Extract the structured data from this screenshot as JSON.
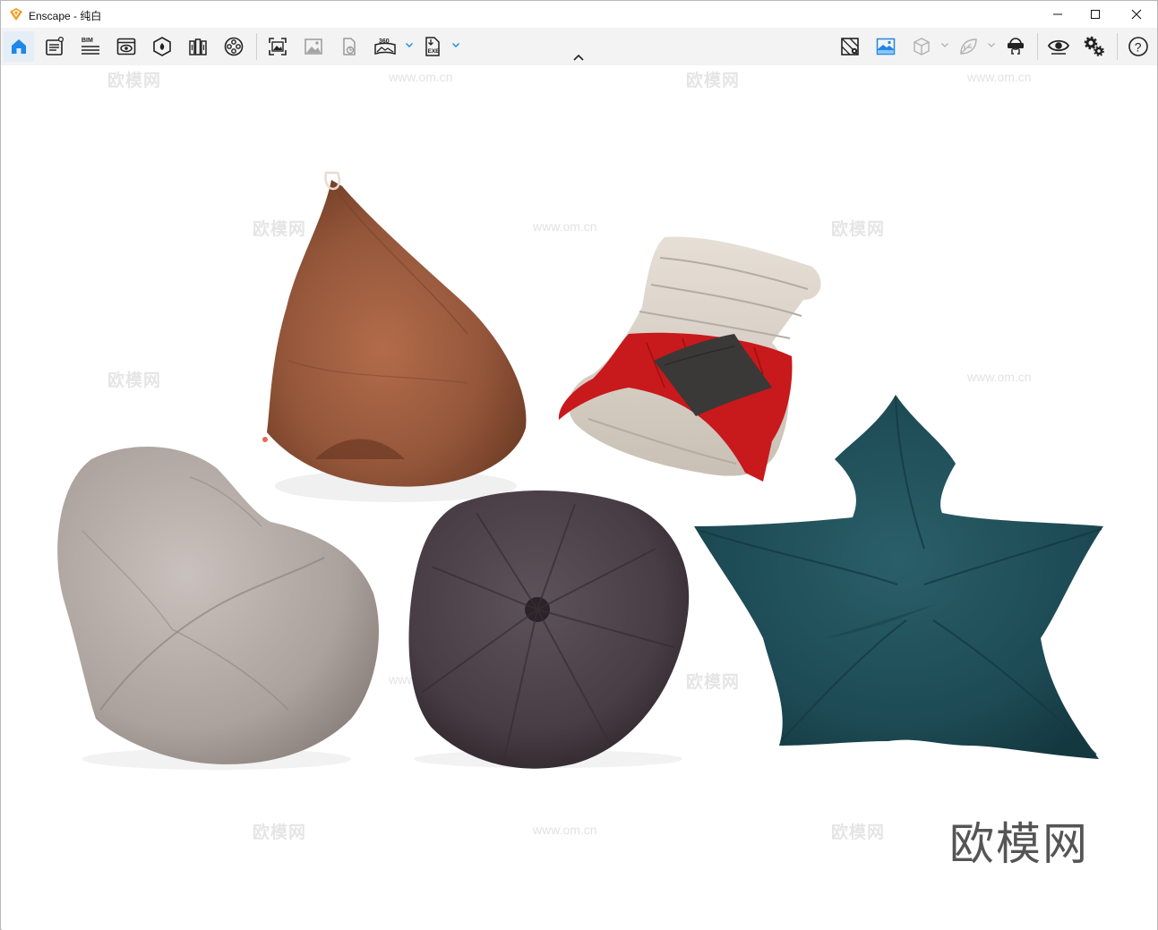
{
  "window": {
    "title": "Enscape - 纯白",
    "controls": [
      "minimize",
      "maximize",
      "close"
    ]
  },
  "toolbar": {
    "left_buttons": [
      {
        "name": "home",
        "icon": "home-icon"
      },
      {
        "name": "settings-sheet",
        "icon": "settings-sheet-icon"
      },
      {
        "name": "bim",
        "icon": "bim-icon",
        "label": "BIM"
      },
      {
        "name": "views",
        "icon": "views-icon"
      },
      {
        "name": "site-context",
        "icon": "site-context-icon"
      },
      {
        "name": "material-library",
        "icon": "library-icon"
      },
      {
        "name": "video-editor",
        "icon": "film-reel-icon"
      },
      {
        "name": "screenshot",
        "icon": "screenshot-icon"
      },
      {
        "name": "batch-render",
        "icon": "image-icon"
      },
      {
        "name": "export-file",
        "icon": "export-file-icon"
      },
      {
        "name": "panorama",
        "icon": "panorama-360-icon",
        "label": "360"
      },
      {
        "name": "exe-export",
        "icon": "exe-file-icon",
        "label": "EXE"
      }
    ],
    "right_buttons": [
      {
        "name": "map",
        "icon": "map-icon"
      },
      {
        "name": "atmosphere",
        "icon": "landscape-icon"
      },
      {
        "name": "cube",
        "icon": "cube-icon"
      },
      {
        "name": "leaf",
        "icon": "leaf-icon"
      },
      {
        "name": "vr-headset",
        "icon": "vr-headset-icon"
      },
      {
        "name": "visibility",
        "icon": "eye-icon"
      },
      {
        "name": "visual-settings",
        "icon": "gears-icon"
      },
      {
        "name": "help",
        "icon": "help-icon",
        "label": "?"
      }
    ],
    "accent_color": "#1e88e5"
  },
  "viewport": {
    "watermark_logo": "欧模网",
    "watermark_url": "www.om.cn",
    "corner_watermark": "欧模网",
    "objects": [
      {
        "name": "teardrop-bean-bag",
        "color": "#9a5a3c"
      },
      {
        "name": "lounger-cushion-with-throw",
        "color": "#d9d2c8"
      },
      {
        "name": "heart-bean-bag",
        "color": "#b8afaa"
      },
      {
        "name": "round-pouf",
        "color": "#4d4248"
      },
      {
        "name": "star-bean-bag",
        "color": "#1f4d57"
      }
    ]
  }
}
